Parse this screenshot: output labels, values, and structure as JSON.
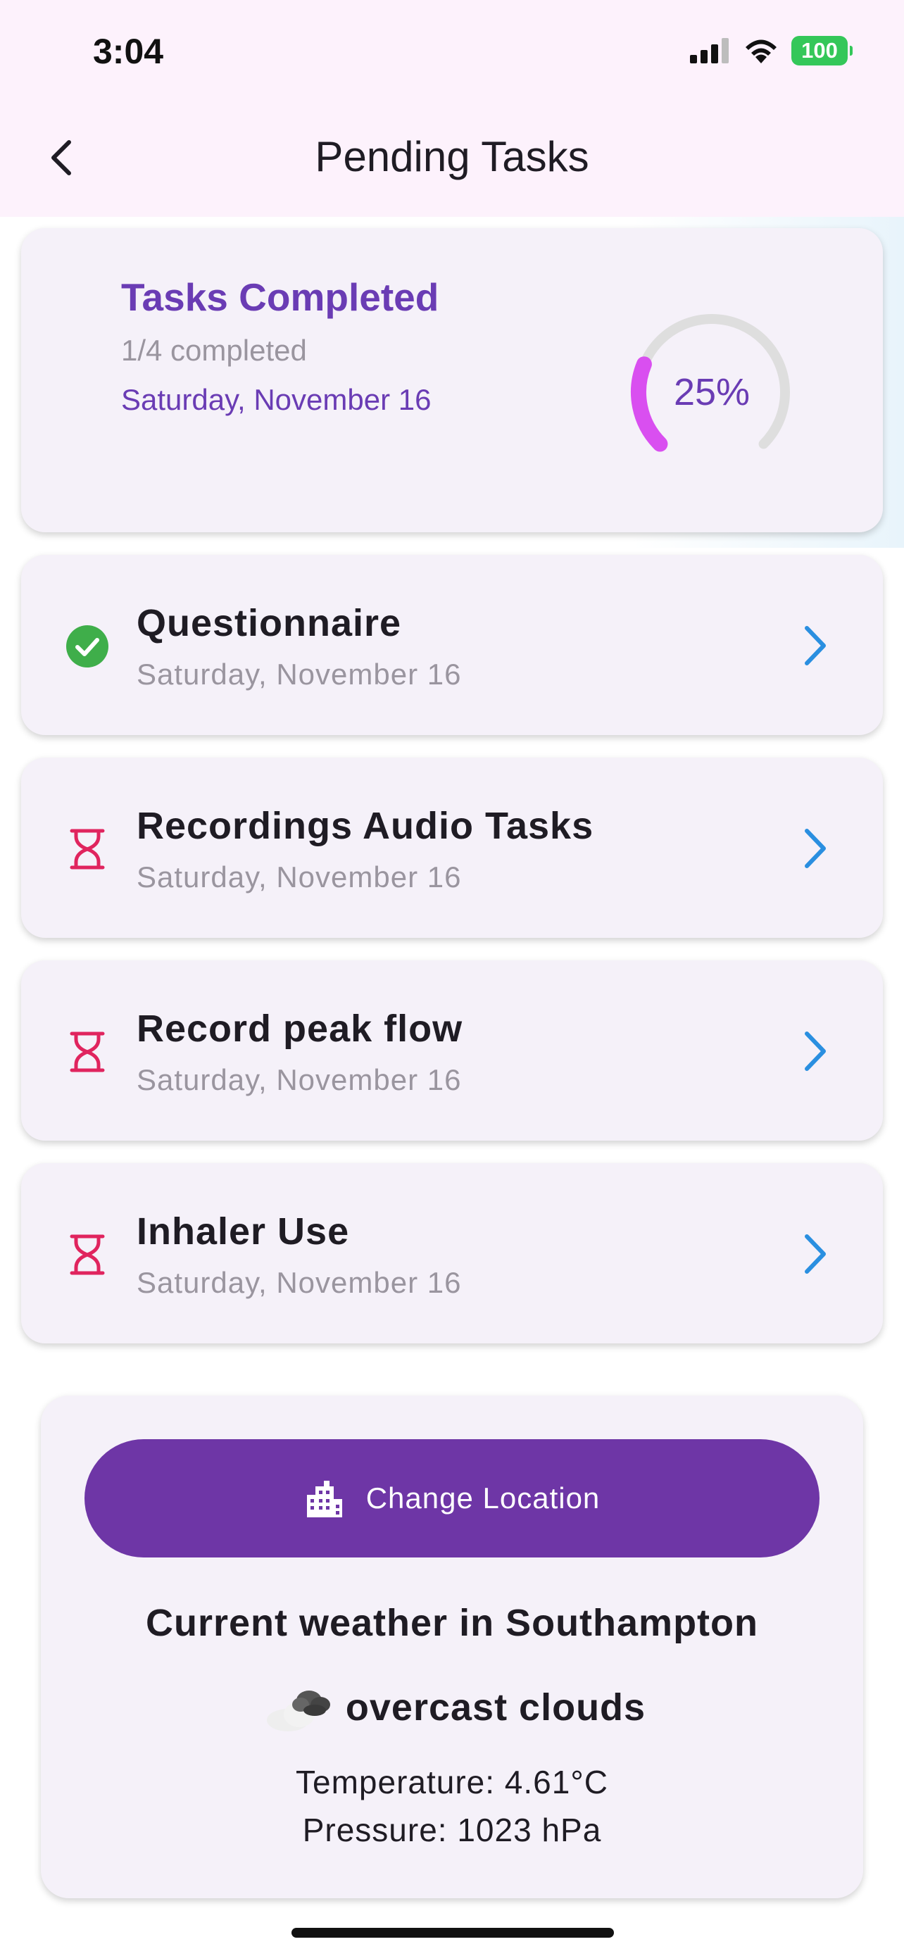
{
  "status_bar": {
    "time": "3:04",
    "battery": "100",
    "battery_color": "#34c759"
  },
  "header": {
    "title": "Pending Tasks",
    "back_icon": "chevron-left-icon"
  },
  "summary": {
    "title": "Tasks Completed",
    "completed_text": "1/4 completed",
    "date": "Saturday, November 16",
    "progress_label": "25%",
    "progress_fraction": 0.25,
    "accent_color": "#6a3cb4",
    "progress_color": "#d94ff0"
  },
  "tasks": [
    {
      "title": "Questionnaire",
      "date": "Saturday, November 16",
      "status": "completed",
      "status_icon": "check-circle-icon"
    },
    {
      "title": "Recordings Audio Tasks",
      "date": "Saturday, November 16",
      "status": "pending",
      "status_icon": "hourglass-icon"
    },
    {
      "title": "Record peak flow",
      "date": "Saturday, November 16",
      "status": "pending",
      "status_icon": "hourglass-icon"
    },
    {
      "title": "Inhaler Use",
      "date": "Saturday, November 16",
      "status": "pending",
      "status_icon": "hourglass-icon"
    }
  ],
  "weather": {
    "button_label": "Change Location",
    "button_icon": "location-city-icon",
    "title": "Current weather in Southampton",
    "description": "overcast clouds",
    "description_icon": "cloud-icon",
    "temperature": "Temperature: 4.61°C",
    "pressure": "Pressure: 1023 hPa",
    "button_color": "#6e36a6"
  }
}
